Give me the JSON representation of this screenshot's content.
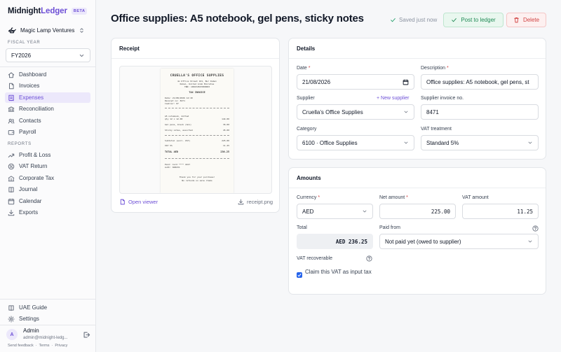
{
  "app": {
    "name_part1": "Midnight",
    "name_part2": "Ledger",
    "badge": "BETA"
  },
  "org": {
    "name": "Magic Lamp Ventures"
  },
  "fiscal_year": {
    "label": "FISCAL YEAR",
    "value": "FY2026"
  },
  "nav": {
    "items": [
      {
        "label": "Dashboard",
        "icon": "home-icon"
      },
      {
        "label": "Invoices",
        "icon": "document-icon"
      },
      {
        "label": "Expenses",
        "icon": "receipt-icon",
        "active": true
      },
      {
        "label": "Reconciliation",
        "icon": "bank-icon"
      },
      {
        "label": "Contacts",
        "icon": "users-icon"
      },
      {
        "label": "Payroll",
        "icon": "wallet-icon"
      }
    ],
    "reports_label": "REPORTS",
    "reports": [
      {
        "label": "Profit & Loss",
        "icon": "trend-icon"
      },
      {
        "label": "VAT Return",
        "icon": "percent-icon"
      },
      {
        "label": "Corporate Tax",
        "icon": "building-icon"
      },
      {
        "label": "Journal",
        "icon": "book-icon"
      },
      {
        "label": "Calendar",
        "icon": "calendar-icon"
      },
      {
        "label": "Exports",
        "icon": "download-icon"
      }
    ],
    "bottom": [
      {
        "label": "UAE Guide",
        "icon": "book-icon"
      },
      {
        "label": "Settings",
        "icon": "gear-icon"
      }
    ]
  },
  "user": {
    "initial": "A",
    "name": "Admin",
    "email": "admin@midnight-ledg..."
  },
  "footer": {
    "feedback": "Send feedback",
    "sep": "·",
    "terms": "Terms",
    "privacy": "Privacy"
  },
  "header": {
    "title": "Office supplies: A5 notebook, gel pens, sticky notes",
    "saved": "Saved just now",
    "post_label": "Post to ledger",
    "delete_label": "Delete"
  },
  "receipt_card": {
    "title": "Receipt",
    "open_viewer": "Open viewer",
    "filename": "receipt.png",
    "paper": {
      "store": "CRUELLA'S OFFICE SUPPLIES",
      "addr1": "4x Office Street 101, Bur Dubai",
      "addr2": "Dubai, United Arab Emirates",
      "trn": "TRN: 100234567800003",
      "type": "TAX INVOICE",
      "date": "Date: 21/08/2026 14:10",
      "receipt_no": "Receipt no: 8471",
      "cashier": "Cashier: 07",
      "items": [
        {
          "name": "A5 notebook, dotted",
          "qty": "qty 12 x 12.00",
          "amt": "144.00"
        },
        {
          "name": "Gel pens, black (box)",
          "qty": "",
          "amt": "36.00"
        },
        {
          "name": "Sticky notes, assorted",
          "qty": "",
          "amt": "45.00"
        }
      ],
      "subtotal_label": "Subtotal (excl. VAT)",
      "subtotal": "225.00",
      "vat_label": "VAT 5%",
      "vat": "11.25",
      "total_label": "TOTAL AED",
      "total": "236.25",
      "paid": "Paid: Card **** 4417",
      "auth": "Auth: 668231",
      "thanks": "Thank you for your purchase!",
      "refund": "No refunds on sale items"
    }
  },
  "details_card": {
    "title": "Details",
    "date_label": "Date",
    "date_value": "21/08/2026",
    "description_label": "Description",
    "description_value": "Office supplies: A5 notebook, gel pens, st",
    "supplier_label": "Supplier",
    "new_supplier": "+ New supplier",
    "supplier_value": "Cruella's Office Supplies",
    "invoice_label": "Supplier invoice no.",
    "invoice_value": "8471",
    "category_label": "Category",
    "category_value": "6100 · Office Supplies",
    "vat_treatment_label": "VAT treatment",
    "vat_treatment_value": "Standard 5%",
    "required_mark": "*"
  },
  "amounts_card": {
    "title": "Amounts",
    "currency_label": "Currency",
    "currency_value": "AED",
    "net_label": "Net amount",
    "net_value": "225.00",
    "vat_label": "VAT amount",
    "vat_value": "11.25",
    "total_label": "Total",
    "total_value": "AED 236.25",
    "paid_from_label": "Paid from",
    "paid_from_value": "Not paid yet (owed to supplier)",
    "vat_recoverable_label": "VAT recoverable",
    "claim_label": "Claim this VAT as input tax",
    "claim_checked": true
  },
  "colors": {
    "accent": "#6d4fd6",
    "success": "#1f8a55",
    "danger": "#d14343",
    "checkbox": "#2563eb"
  }
}
